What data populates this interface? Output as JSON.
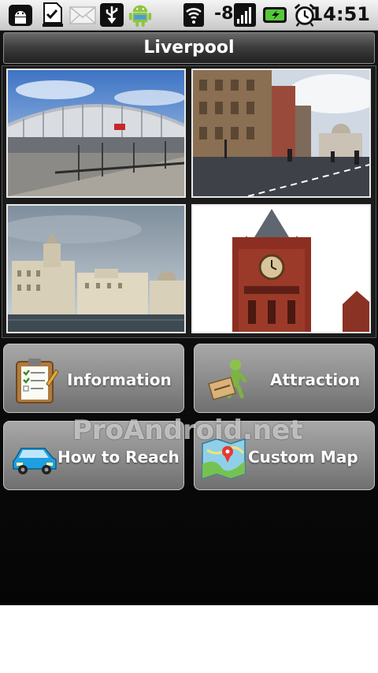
{
  "status_bar": {
    "signal_strength": "-8",
    "time": "14:51",
    "icons": [
      "android-debug-icon",
      "download-done-icon",
      "mail-icon",
      "usb-icon",
      "android-robot-icon",
      "wifi-icon",
      "signal-bars-icon",
      "battery-charging-icon",
      "alarm-clock-icon"
    ]
  },
  "header": {
    "title": "Liverpool"
  },
  "gallery": {
    "photos": [
      "lime-street-station-photo",
      "city-square-photo",
      "waterfront-skyline-photo",
      "clock-tower-photo"
    ]
  },
  "menu": {
    "items": [
      {
        "label": "Information",
        "icon": "clipboard-icon"
      },
      {
        "label": "Attraction",
        "icon": "welcome-figure-icon"
      },
      {
        "label": "How to Reach",
        "icon": "car-icon"
      },
      {
        "label": "Custom Map",
        "icon": "map-pin-icon"
      }
    ]
  },
  "watermark": "ProAndroid.net",
  "colors": {
    "accent": "#7a7a7a",
    "title_text": "#ffffff"
  }
}
